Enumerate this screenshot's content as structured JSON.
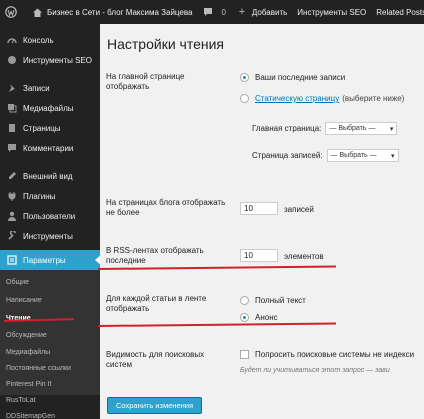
{
  "adminbar": {
    "site_title": "Бизнес в Сети - блог Максима Зайцева",
    "comments_count": "0",
    "add_new": "Добавить",
    "seo_tools": "Инструменты SEO",
    "related_posts": "Related Posts"
  },
  "sidebar": {
    "items": [
      {
        "label": "Консоль",
        "icon": "dashboard-icon"
      },
      {
        "label": "Инструменты SEO",
        "icon": "seo-icon"
      },
      {
        "label": "Записи",
        "icon": "pin-icon"
      },
      {
        "label": "Медиафайлы",
        "icon": "media-icon"
      },
      {
        "label": "Страницы",
        "icon": "pages-icon"
      },
      {
        "label": "Комментарии",
        "icon": "comments-icon"
      },
      {
        "label": "Внешний вид",
        "icon": "appearance-icon"
      },
      {
        "label": "Плагины",
        "icon": "plugins-icon"
      },
      {
        "label": "Пользователи",
        "icon": "users-icon"
      },
      {
        "label": "Инструменты",
        "icon": "tools-icon"
      },
      {
        "label": "Параметры",
        "icon": "settings-icon"
      }
    ],
    "submenu": [
      "Общие",
      "Написание",
      "Чтение",
      "Обсуждение",
      "Медиафайлы",
      "Постоянные ссылки",
      "Pinterest Pin It",
      "RusToLat",
      "DDSitemapGen"
    ]
  },
  "main": {
    "title": "Настройки чтения",
    "front_page_label": "На главной странице отображать",
    "option_latest_posts": "Ваши последние записи",
    "option_static_page": "Статическую страницу",
    "option_static_hint": "(выберите ниже)",
    "front_page_select_label": "Главная страница:",
    "posts_page_select_label": "Страница записей:",
    "select_placeholder": "— Выбрать —",
    "posts_per_page_label": "На страницах блога отображать не более",
    "posts_per_page_value": "10",
    "posts_per_page_unit": "записей",
    "rss_label": "В RSS-лентах отображать последние",
    "rss_value": "10",
    "rss_unit": "элементов",
    "feed_article_label": "Для каждой статьи в ленте отображать",
    "option_full_text": "Полный текст",
    "option_summary": "Анонс",
    "visibility_label": "Видимость для поисковых систем",
    "visibility_checkbox": "Попросить поисковые системы не индекси",
    "visibility_hint": "Будет ли учитываться этот запрос — зави",
    "save_button": "Сохранить изменения"
  },
  "colors": {
    "accent": "#2ea2cc",
    "sidebar_bg": "#222222",
    "annotation_red": "#d0202a"
  }
}
